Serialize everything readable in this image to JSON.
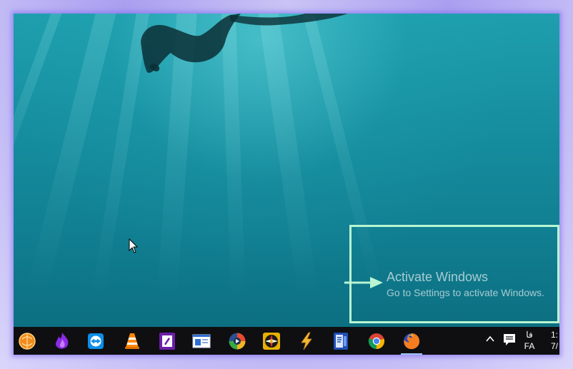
{
  "desktop": {
    "wallpaper": "underwater-swimmer",
    "watermark": {
      "title": "Activate Windows",
      "subtitle": "Go to Settings to activate Windows."
    }
  },
  "taskbar": {
    "pinned": [
      {
        "name": "orange-ball-app",
        "icon": "orange-ball-icon"
      },
      {
        "name": "purple-flame-app",
        "icon": "purple-flame-icon"
      },
      {
        "name": "teamviewer",
        "icon": "teamviewer-icon"
      },
      {
        "name": "vlc",
        "icon": "vlc-cone-icon"
      },
      {
        "name": "purple-editor",
        "icon": "purple-document-icon"
      },
      {
        "name": "window-app",
        "icon": "window-app-icon"
      },
      {
        "name": "media-player",
        "icon": "media-player-icon"
      },
      {
        "name": "compass-app",
        "icon": "compass-icon"
      },
      {
        "name": "lightning-app",
        "icon": "lightning-icon"
      },
      {
        "name": "blue-book-app",
        "icon": "blue-book-icon"
      },
      {
        "name": "chrome",
        "icon": "chrome-icon"
      },
      {
        "name": "firefox",
        "icon": "firefox-icon",
        "active": true
      }
    ],
    "tray": {
      "language_script": "فا",
      "language_code": "FA",
      "time": "1:",
      "date": "7/"
    }
  },
  "colors": {
    "highlight": "#b9f5d2",
    "taskbar": "#0f0f12",
    "frame_glow": "#a99ff0"
  }
}
